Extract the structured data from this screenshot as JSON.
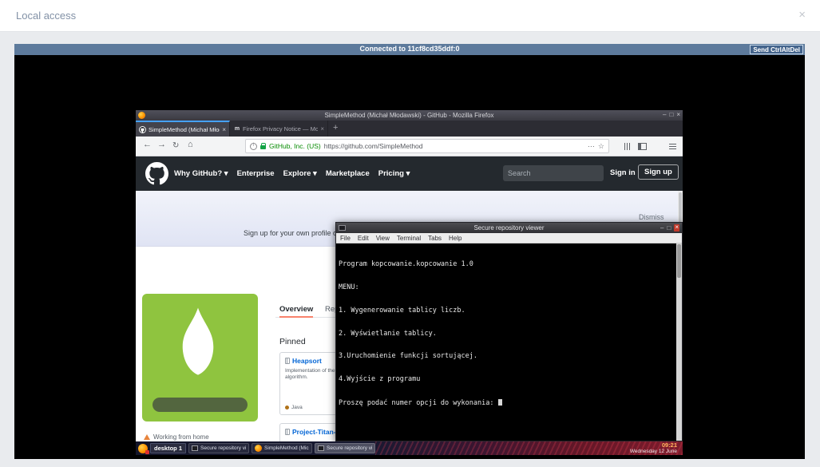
{
  "local_access": {
    "title": "Local access",
    "close_icon": "×"
  },
  "console": {
    "status": "Connected to 11cf8cd35ddf:0",
    "send_button": "Send CtrlAltDel"
  },
  "firefox": {
    "window_title": "SimpleMethod (Michał Młodawski) - GitHub - Mozilla Firefox",
    "controls": {
      "minimize": "–",
      "maximize": "□",
      "close": "×"
    },
    "tabs": [
      {
        "label": "SimpleMethod (Michał Młod...",
        "close": "×"
      },
      {
        "label": "Firefox Privacy Notice — Mo...",
        "close": "×"
      }
    ],
    "tab2_favicon_letter": "m",
    "new_tab_button": "+",
    "nav": {
      "back": "←",
      "forward": "→",
      "reload": "↻",
      "home": "⌂"
    },
    "urlbar": {
      "security_label": "GitHub, Inc. (US)",
      "url": "https://github.com/SimpleMethod",
      "page_actions": "⋯",
      "bookmark_star": "☆"
    }
  },
  "github": {
    "nav_items": [
      "Why GitHub? ▾",
      "Enterprise",
      "Explore ▾",
      "Marketplace",
      "Pricing ▾"
    ],
    "search_placeholder": "Search",
    "sign_in": "Sign in",
    "sign_up": "Sign up",
    "banner": {
      "text": "Sign up for your own profile on GitH",
      "dismiss": "Dismiss"
    },
    "profile": {
      "status": "Working from home",
      "tab_overview": "Overview",
      "tab_repositories": "Rep",
      "pinned_heading": "Pinned",
      "repo1": {
        "name": "Heapsort",
        "description_line1": "Implementation of the",
        "description_line2": "algorithm.",
        "language": "Java"
      },
      "repo2": {
        "name": "Project-Titan-"
      }
    }
  },
  "terminal": {
    "title": "Secure repository viewer",
    "controls": {
      "minimize": "–",
      "maximize": "□",
      "close": "×"
    },
    "menu_items": [
      "File",
      "Edit",
      "View",
      "Terminal",
      "Tabs",
      "Help"
    ],
    "lines": [
      "Program kopcowanie.kopcowanie 1.0",
      "MENU:",
      "1. Wygenerowanie tablicy liczb.",
      "2. Wyświetlanie tablicy.",
      "3.Uruchomienie funkcji sortującej.",
      "4.Wyjście z programu",
      "Proszę podać numer opcji do wykonania: "
    ]
  },
  "taskbar": {
    "desktop_label": "desktop 1",
    "tasks": [
      {
        "label": "Secure repository vie..."
      },
      {
        "label": "SimpleMethod (Mich..."
      },
      {
        "label": "Secure repository vie..."
      }
    ],
    "clock": {
      "time": "09:21",
      "date": "Wednesday 12 June"
    }
  },
  "colors": {
    "console_header": "#5d7a9c",
    "github_header": "#24292e",
    "repo_link": "#0366d6",
    "java_dot": "#b07219",
    "avatar_green": "#8fc43f",
    "tab_underline": "#f9826c"
  }
}
